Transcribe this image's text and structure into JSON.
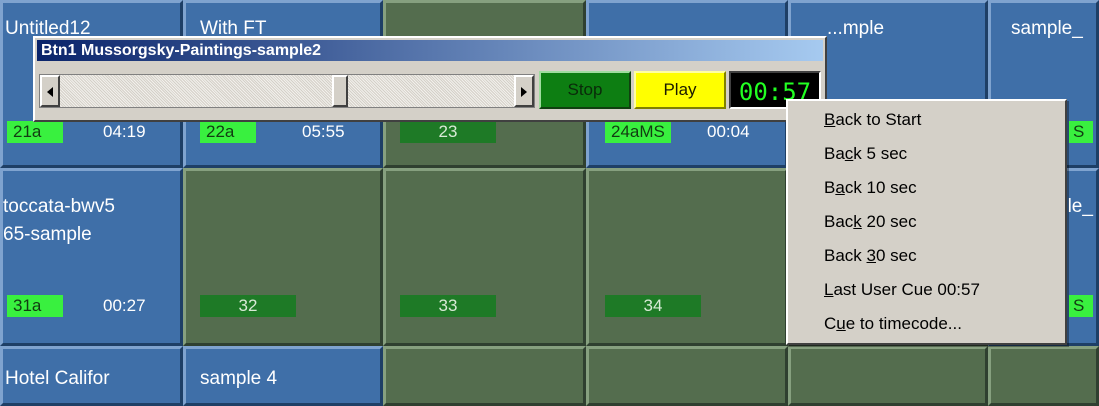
{
  "grid": {
    "row1": [
      {
        "title": "Untitled12",
        "num": "21a",
        "dur": "04:19"
      },
      {
        "title": "With FT",
        "num": "22a",
        "dur": "05:55"
      },
      {
        "title": "",
        "num": "23",
        "dur": ""
      },
      {
        "title": "",
        "num": "24aMS",
        "dur": "00:04"
      },
      {
        "title": "...mple",
        "num": "",
        "dur": ""
      },
      {
        "title": "sample_",
        "num": "S",
        "dur": ""
      }
    ],
    "row2": [
      {
        "title": "toccata-bwv5\n65-sample",
        "num": "31a",
        "dur": "00:27"
      },
      {
        "title": "",
        "num": "32",
        "dur": ""
      },
      {
        "title": "",
        "num": "33",
        "dur": ""
      },
      {
        "title": "",
        "num": "34",
        "dur": ""
      },
      {
        "title": "",
        "num": "",
        "dur": ""
      },
      {
        "title": "ple_",
        "num": "S",
        "dur": ""
      }
    ],
    "row3": [
      {
        "title": "Hotel Califor",
        "num": "",
        "dur": ""
      },
      {
        "title": "sample 4",
        "num": "",
        "dur": ""
      }
    ]
  },
  "player": {
    "title": "Btn1  Mussorgsky-Paintings-sample2",
    "position_fraction": 0.62,
    "stop_label": "Stop",
    "play_label": "Play",
    "time": "00:57"
  },
  "context_menu": {
    "items": [
      {
        "pre": "",
        "u": "B",
        "post": "ack to Start"
      },
      {
        "pre": "Ba",
        "u": "c",
        "post": "k 5 sec"
      },
      {
        "pre": "B",
        "u": "a",
        "post": "ck 10 sec"
      },
      {
        "pre": "Bac",
        "u": "k",
        "post": " 20 sec"
      },
      {
        "pre": "Back ",
        "u": "3",
        "post": "0 sec"
      },
      {
        "pre": "",
        "u": "L",
        "post": "ast User Cue 00:57"
      },
      {
        "pre": "C",
        "u": "u",
        "post": "e to timecode..."
      }
    ]
  },
  "colors": {
    "blue_cell": "#3f6fa8",
    "green_cell": "#546d4e",
    "label_bright": "#39f03f",
    "label_dark": "#1e7a26"
  }
}
